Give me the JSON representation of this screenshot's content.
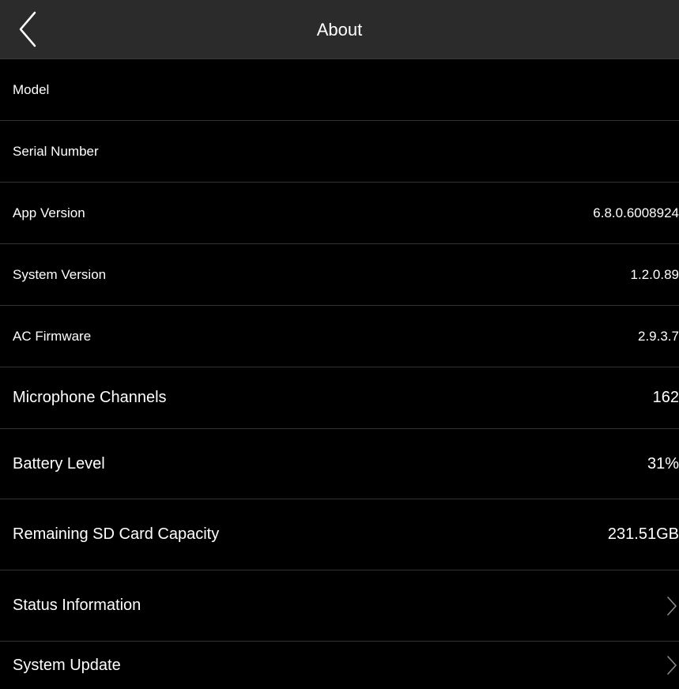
{
  "header": {
    "title": "About",
    "back_icon": "chevron-left-icon"
  },
  "rows": [
    {
      "label": "Model",
      "value": ""
    },
    {
      "label": "Serial Number",
      "value": ""
    },
    {
      "label": "App Version",
      "value": "6.8.0.6008924"
    },
    {
      "label": "System Version",
      "value": "1.2.0.89"
    },
    {
      "label": "AC Firmware",
      "value": "2.9.3.7"
    },
    {
      "label": "Microphone Channels",
      "value": "162"
    },
    {
      "label": "Battery Level",
      "value": "31%"
    },
    {
      "label": "Remaining SD Card Capacity",
      "value": "231.51GB"
    },
    {
      "label": "Status Information",
      "icon": "chevron-right-icon"
    },
    {
      "label": "System Update",
      "icon": "chevron-right-icon"
    }
  ],
  "colors": {
    "background": "#000000",
    "header_background": "#2b2b2b",
    "divider": "#333333",
    "text": "#ffffff",
    "chevron": "#8a8a8a"
  }
}
